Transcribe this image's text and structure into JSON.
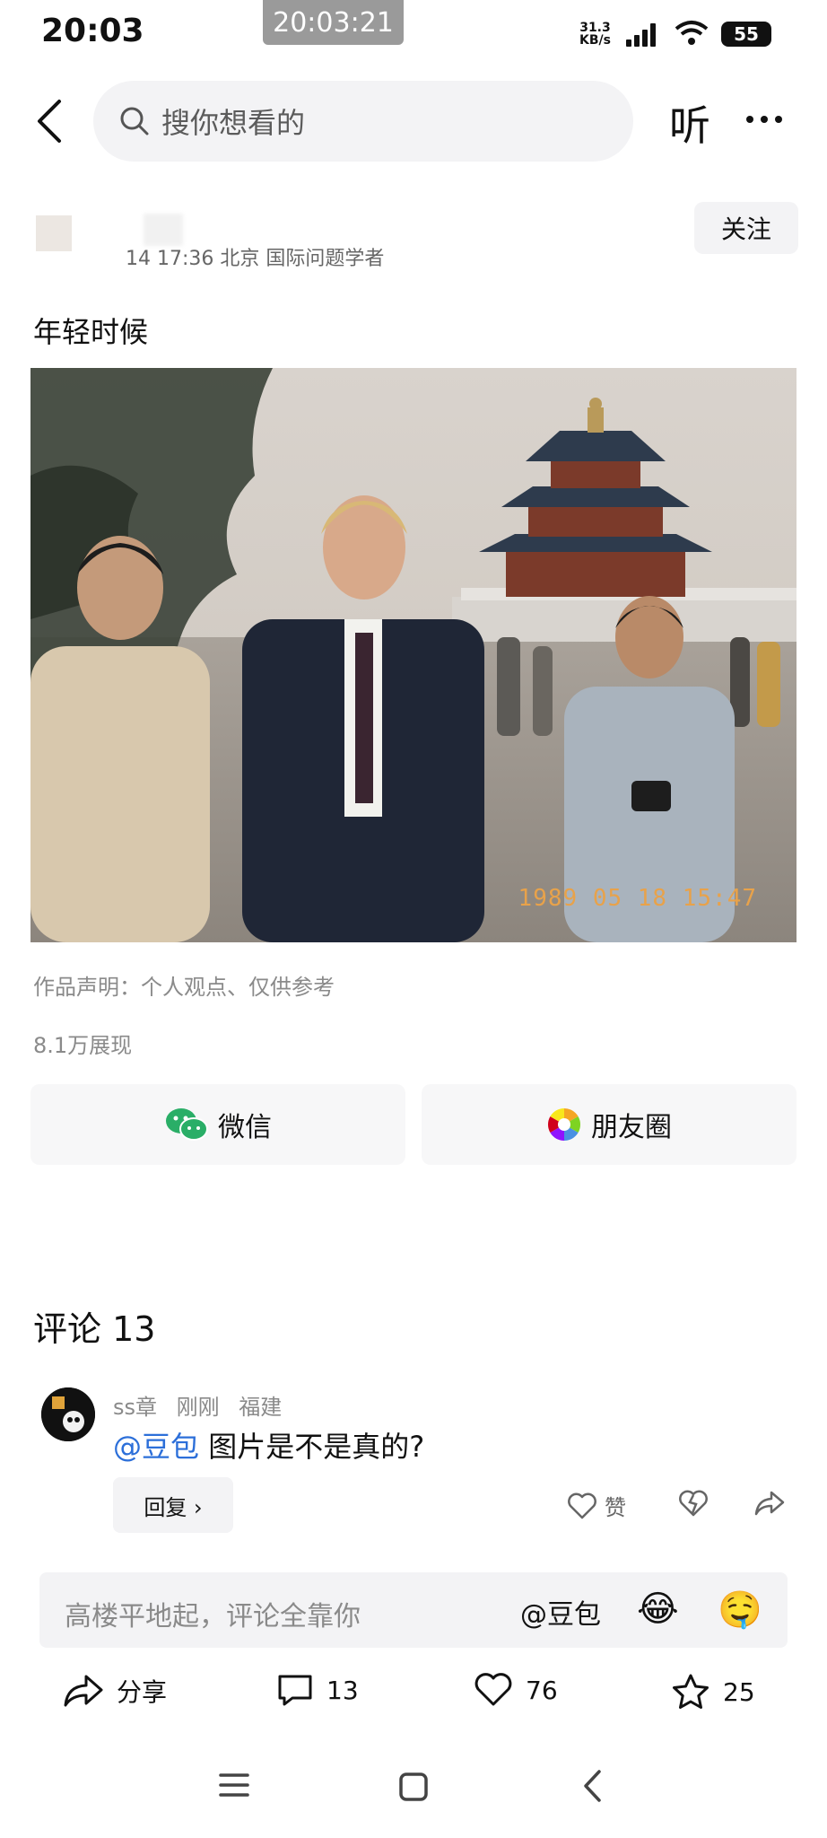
{
  "status_bar": {
    "time": "20:03",
    "overlay_time": "20:03:21",
    "net_speed_value": "31.3",
    "net_speed_unit": "KB/s",
    "battery": "55"
  },
  "header": {
    "search_placeholder": "搜你想看的",
    "listen_label": "听"
  },
  "author": {
    "meta": "14 17:36 北京 国际问题学者",
    "follow_label": "关注"
  },
  "post": {
    "text": "年轻时候",
    "photo_date_stamp": "1989 05 18 15:47",
    "statement": "作品声明：个人观点、仅供参考",
    "views": "8.1万展现"
  },
  "share": {
    "wechat_label": "微信",
    "moments_label": "朋友圈"
  },
  "comments": {
    "title": "评论 13",
    "items": [
      {
        "user": "ss章",
        "time": "刚刚",
        "location": "福建",
        "mention": "@豆包",
        "text": "图片是不是真的?",
        "reply_label": "回复 ›",
        "like_label": "赞"
      }
    ]
  },
  "input": {
    "placeholder": "高楼平地起，评论全靠你",
    "mention_label": "@豆包",
    "emoji1": "😂",
    "emoji2": "🤤"
  },
  "actions": {
    "share_label": "分享",
    "comment_count": "13",
    "like_count": "76",
    "favorite_count": "25"
  },
  "colors": {
    "mention_blue": "#2c6fd9",
    "wechat_green": "#2aae67"
  }
}
